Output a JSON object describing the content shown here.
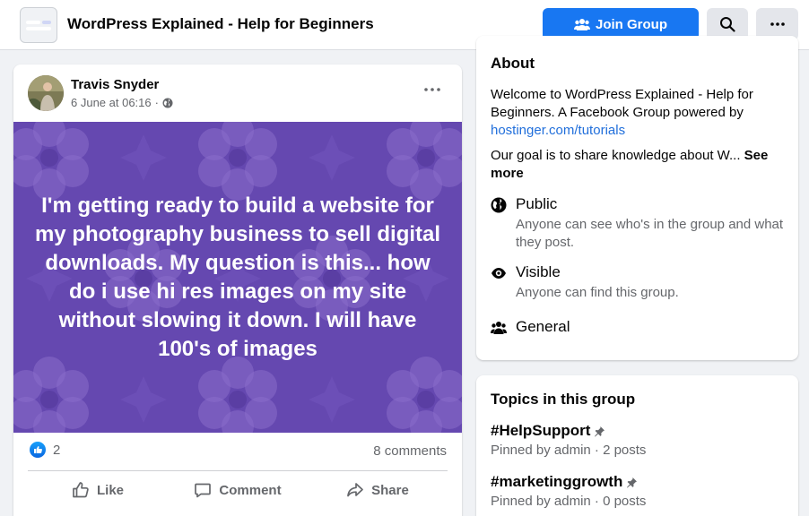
{
  "header": {
    "group_title": "WordPress Explained - Help for Beginners",
    "join_label": "Join Group",
    "accent_color": "#1877f2"
  },
  "post": {
    "author": "Travis Snyder",
    "timestamp": "6 June at 06:16",
    "text": "I'm getting ready to build a website for my photography business to sell digital downloads. My question is this... how do i use hi res images on my site without slowing it down. I will have 100's of images",
    "background_color": "#6548b0",
    "reaction_count": "2",
    "comments": "8 comments",
    "actions": {
      "like": "Like",
      "comment": "Comment",
      "share": "Share"
    }
  },
  "about": {
    "heading": "About",
    "description_prefix": "Welcome to WordPress Explained - Help for Beginners. A Facebook Group powered by ",
    "link": "hostinger.com/tutorials",
    "goal": "Our goal is to share knowledge about W...",
    "see_more": "See more",
    "public_title": "Public",
    "public_desc": "Anyone can see who's in the group and what they post.",
    "visible_title": "Visible",
    "visible_desc": "Anyone can find this group.",
    "general_title": "General"
  },
  "topics": {
    "heading": "Topics in this group",
    "items": [
      {
        "name": "#HelpSupport",
        "meta": "Pinned by admin · 2 posts"
      },
      {
        "name": "#marketinggrowth",
        "meta": "Pinned by admin · 0 posts"
      }
    ]
  },
  "icons": [
    "group-thumbnail-icon",
    "join-group-icon",
    "search-icon",
    "more-icon",
    "globe-icon",
    "post-menu-icon",
    "like-reaction-icon",
    "like-icon",
    "comment-icon",
    "share-icon",
    "public-globe-icon",
    "eye-icon",
    "general-people-icon",
    "pin-icon"
  ]
}
